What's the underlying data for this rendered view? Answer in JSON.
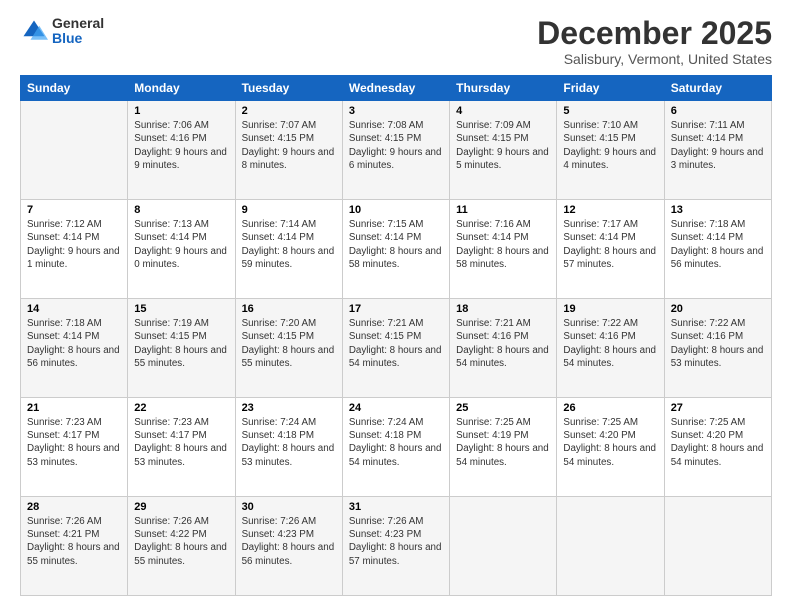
{
  "logo": {
    "general": "General",
    "blue": "Blue"
  },
  "title": "December 2025",
  "subtitle": "Salisbury, Vermont, United States",
  "days": [
    "Sunday",
    "Monday",
    "Tuesday",
    "Wednesday",
    "Thursday",
    "Friday",
    "Saturday"
  ],
  "weeks": [
    [
      {
        "date": "",
        "sunrise": "",
        "sunset": "",
        "daylight": ""
      },
      {
        "date": "1",
        "sunrise": "7:06 AM",
        "sunset": "4:16 PM",
        "daylight": "9 hours and 9 minutes."
      },
      {
        "date": "2",
        "sunrise": "7:07 AM",
        "sunset": "4:15 PM",
        "daylight": "9 hours and 8 minutes."
      },
      {
        "date": "3",
        "sunrise": "7:08 AM",
        "sunset": "4:15 PM",
        "daylight": "9 hours and 6 minutes."
      },
      {
        "date": "4",
        "sunrise": "7:09 AM",
        "sunset": "4:15 PM",
        "daylight": "9 hours and 5 minutes."
      },
      {
        "date": "5",
        "sunrise": "7:10 AM",
        "sunset": "4:15 PM",
        "daylight": "9 hours and 4 minutes."
      },
      {
        "date": "6",
        "sunrise": "7:11 AM",
        "sunset": "4:14 PM",
        "daylight": "9 hours and 3 minutes."
      }
    ],
    [
      {
        "date": "7",
        "sunrise": "7:12 AM",
        "sunset": "4:14 PM",
        "daylight": "9 hours and 1 minute."
      },
      {
        "date": "8",
        "sunrise": "7:13 AM",
        "sunset": "4:14 PM",
        "daylight": "9 hours and 0 minutes."
      },
      {
        "date": "9",
        "sunrise": "7:14 AM",
        "sunset": "4:14 PM",
        "daylight": "8 hours and 59 minutes."
      },
      {
        "date": "10",
        "sunrise": "7:15 AM",
        "sunset": "4:14 PM",
        "daylight": "8 hours and 58 minutes."
      },
      {
        "date": "11",
        "sunrise": "7:16 AM",
        "sunset": "4:14 PM",
        "daylight": "8 hours and 58 minutes."
      },
      {
        "date": "12",
        "sunrise": "7:17 AM",
        "sunset": "4:14 PM",
        "daylight": "8 hours and 57 minutes."
      },
      {
        "date": "13",
        "sunrise": "7:18 AM",
        "sunset": "4:14 PM",
        "daylight": "8 hours and 56 minutes."
      }
    ],
    [
      {
        "date": "14",
        "sunrise": "7:18 AM",
        "sunset": "4:14 PM",
        "daylight": "8 hours and 56 minutes."
      },
      {
        "date": "15",
        "sunrise": "7:19 AM",
        "sunset": "4:15 PM",
        "daylight": "8 hours and 55 minutes."
      },
      {
        "date": "16",
        "sunrise": "7:20 AM",
        "sunset": "4:15 PM",
        "daylight": "8 hours and 55 minutes."
      },
      {
        "date": "17",
        "sunrise": "7:21 AM",
        "sunset": "4:15 PM",
        "daylight": "8 hours and 54 minutes."
      },
      {
        "date": "18",
        "sunrise": "7:21 AM",
        "sunset": "4:16 PM",
        "daylight": "8 hours and 54 minutes."
      },
      {
        "date": "19",
        "sunrise": "7:22 AM",
        "sunset": "4:16 PM",
        "daylight": "8 hours and 54 minutes."
      },
      {
        "date": "20",
        "sunrise": "7:22 AM",
        "sunset": "4:16 PM",
        "daylight": "8 hours and 53 minutes."
      }
    ],
    [
      {
        "date": "21",
        "sunrise": "7:23 AM",
        "sunset": "4:17 PM",
        "daylight": "8 hours and 53 minutes."
      },
      {
        "date": "22",
        "sunrise": "7:23 AM",
        "sunset": "4:17 PM",
        "daylight": "8 hours and 53 minutes."
      },
      {
        "date": "23",
        "sunrise": "7:24 AM",
        "sunset": "4:18 PM",
        "daylight": "8 hours and 53 minutes."
      },
      {
        "date": "24",
        "sunrise": "7:24 AM",
        "sunset": "4:18 PM",
        "daylight": "8 hours and 54 minutes."
      },
      {
        "date": "25",
        "sunrise": "7:25 AM",
        "sunset": "4:19 PM",
        "daylight": "8 hours and 54 minutes."
      },
      {
        "date": "26",
        "sunrise": "7:25 AM",
        "sunset": "4:20 PM",
        "daylight": "8 hours and 54 minutes."
      },
      {
        "date": "27",
        "sunrise": "7:25 AM",
        "sunset": "4:20 PM",
        "daylight": "8 hours and 54 minutes."
      }
    ],
    [
      {
        "date": "28",
        "sunrise": "7:26 AM",
        "sunset": "4:21 PM",
        "daylight": "8 hours and 55 minutes."
      },
      {
        "date": "29",
        "sunrise": "7:26 AM",
        "sunset": "4:22 PM",
        "daylight": "8 hours and 55 minutes."
      },
      {
        "date": "30",
        "sunrise": "7:26 AM",
        "sunset": "4:23 PM",
        "daylight": "8 hours and 56 minutes."
      },
      {
        "date": "31",
        "sunrise": "7:26 AM",
        "sunset": "4:23 PM",
        "daylight": "8 hours and 57 minutes."
      },
      {
        "date": "",
        "sunrise": "",
        "sunset": "",
        "daylight": ""
      },
      {
        "date": "",
        "sunrise": "",
        "sunset": "",
        "daylight": ""
      },
      {
        "date": "",
        "sunrise": "",
        "sunset": "",
        "daylight": ""
      }
    ]
  ]
}
